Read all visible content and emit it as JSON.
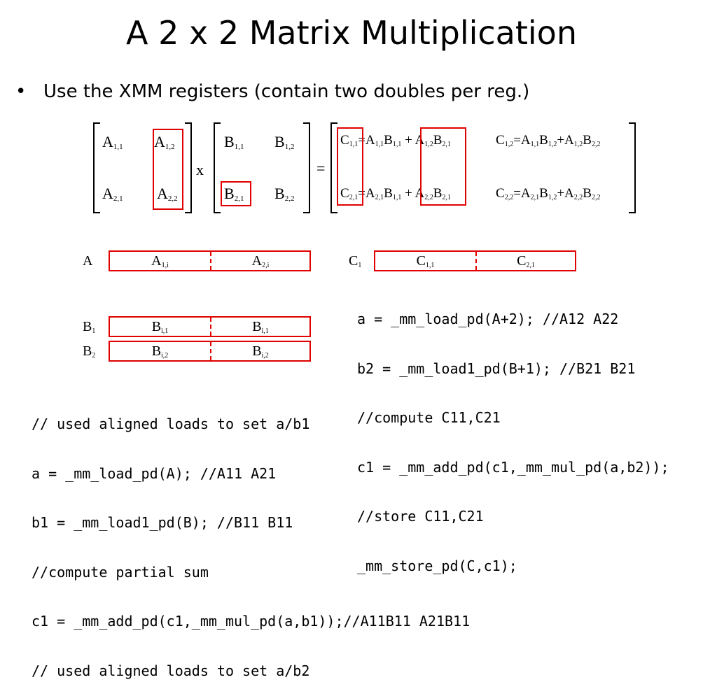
{
  "title": "A 2 x 2 Matrix Multiplication",
  "bullet": {
    "marker": "•",
    "text": "Use the XMM registers (contain two doubles per reg.)"
  },
  "matrix": {
    "A": [
      [
        "A",
        "1,1"
      ],
      [
        "A",
        "1,2"
      ],
      [
        "A",
        "2,1"
      ],
      [
        "A",
        "2,2"
      ]
    ],
    "B": [
      [
        "B",
        "1,1"
      ],
      [
        "B",
        "1,2"
      ],
      [
        "B",
        "2,1"
      ],
      [
        "B",
        "2,2"
      ]
    ],
    "times": "x",
    "equals": "=",
    "C": [
      {
        "c": [
          "C",
          "1,1"
        ],
        "eq": "=",
        "t1": [
          [
            "A",
            "1,1"
          ],
          [
            "B",
            "1,1"
          ]
        ],
        "plus": "+",
        "t2": [
          [
            "A",
            "1,2"
          ],
          [
            "B",
            "2,1"
          ]
        ]
      },
      {
        "c": [
          "C",
          "1,2"
        ],
        "eq": "=",
        "t1": [
          [
            "A",
            "1,1"
          ],
          [
            "B",
            "1,2"
          ]
        ],
        "plus": "+",
        "t2": [
          [
            "A",
            "1,2"
          ],
          [
            "B",
            "2,2"
          ]
        ]
      },
      {
        "c": [
          "C",
          "2,1"
        ],
        "eq": "=",
        "t1": [
          [
            "A",
            "2,1"
          ],
          [
            "B",
            "1,1"
          ]
        ],
        "plus": "+",
        "t2": [
          [
            "A",
            "2,2"
          ],
          [
            "B",
            "2,1"
          ]
        ]
      },
      {
        "c": [
          "C",
          "2,2"
        ],
        "eq": "=",
        "t1": [
          [
            "A",
            "2,1"
          ],
          [
            "B",
            "1,2"
          ]
        ],
        "plus": "+",
        "t2": [
          [
            "A",
            "2,2"
          ],
          [
            "B",
            "2,2"
          ]
        ]
      }
    ]
  },
  "registers": {
    "A": {
      "label": "A",
      "sub": "",
      "left": [
        "A",
        "1,i"
      ],
      "right": [
        "A",
        "2,i"
      ]
    },
    "B1": {
      "label": "B",
      "sub": "1",
      "left": [
        "B",
        "i,1"
      ],
      "right": [
        "B",
        "i,1"
      ]
    },
    "B2": {
      "label": "B",
      "sub": "2",
      "left": [
        "B",
        "i,2"
      ],
      "right": [
        "B",
        "i,2"
      ]
    },
    "C1": {
      "label": "C",
      "sub": "1",
      "left": [
        "C",
        "1,1"
      ],
      "right": [
        "C",
        "2,1"
      ]
    }
  },
  "code_right": [
    "a = _mm_load_pd(A+2); //A12 A22",
    "b2 = _mm_load1_pd(B+1); //B21 B21",
    "//compute C11,C21",
    "c1 = _mm_add_pd(c1,_mm_mul_pd(a,b2));",
    "//store C11,C21",
    "_mm_store_pd(C,c1);"
  ],
  "code_left": [
    "// used aligned loads to set a/b1",
    "a = _mm_load_pd(A); //A11 A21",
    "b1 = _mm_load1_pd(B); //B11 B11",
    "//compute partial sum",
    "c1 = _mm_add_pd(c1,_mm_mul_pd(a,b1));//A11B11 A21B11",
    "// used aligned loads to set a/b2"
  ],
  "colors": {
    "highlight": "#e00000",
    "text": "#000000",
    "background": "#ffffff"
  }
}
